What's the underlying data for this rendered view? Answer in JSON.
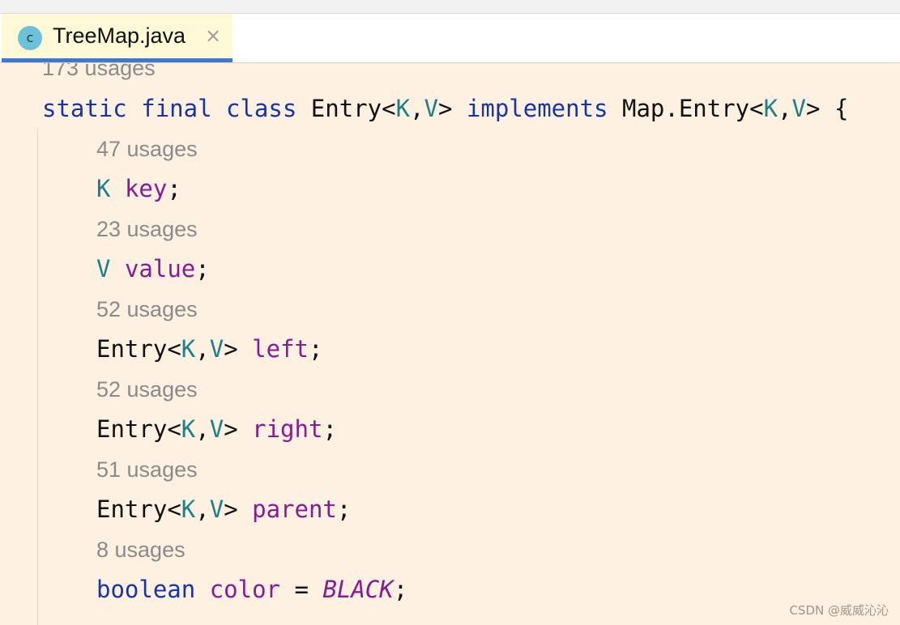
{
  "tab": {
    "icon_letter": "c",
    "title": "TreeMap.java",
    "close_glyph": "×"
  },
  "code": {
    "class_usages": "173 usages",
    "class_decl": {
      "kw1": "static",
      "kw2": "final",
      "kw3": "class",
      "name": "Entry",
      "lt": "<",
      "tk": "K",
      "comma": ",",
      "tv": "V",
      "gt": ">",
      "kw4": "implements",
      "iface": "Map.Entry",
      "lt2": "<",
      "tk2": "K",
      "comma2": ",",
      "tv2": "V",
      "gt2": ">",
      "brace": "{"
    },
    "fields": [
      {
        "usages": "47 usages",
        "type": "K",
        "generic": false,
        "name": "key",
        "end": ";"
      },
      {
        "usages": "23 usages",
        "type": "V",
        "generic": false,
        "name": "value",
        "end": ";"
      },
      {
        "usages": "52 usages",
        "type": "Entry",
        "generic": true,
        "tk": "K",
        "tv": "V",
        "name": "left",
        "end": ";"
      },
      {
        "usages": "52 usages",
        "type": "Entry",
        "generic": true,
        "tk": "K",
        "tv": "V",
        "name": "right",
        "end": ";"
      },
      {
        "usages": "51 usages",
        "type": "Entry",
        "generic": true,
        "tk": "K",
        "tv": "V",
        "name": "parent",
        "end": ";"
      }
    ],
    "last_field": {
      "usages": "8 usages",
      "type": "boolean",
      "name": "color",
      "eq": "=",
      "value": "BLACK",
      "end": ";"
    }
  },
  "watermark": "CSDN @威威沁沁",
  "colors": {
    "editor_bg": "#fff1e2",
    "keyword": "#1733a6",
    "type_param": "#1d7f89",
    "field": "#861b93",
    "hint": "#8a8a8a",
    "tab_underline": "#3b79d3"
  }
}
